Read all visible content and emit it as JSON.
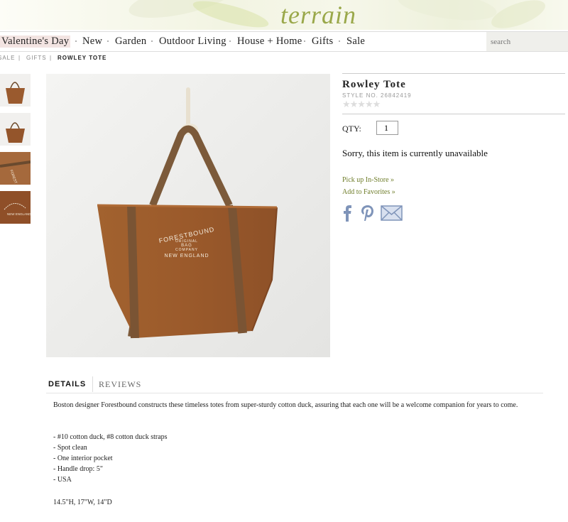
{
  "brand": {
    "logo_text": "terrain",
    "accent": "#9aa84a"
  },
  "nav": {
    "items": [
      "Valentine's Day",
      "New",
      "Garden",
      "Outdoor Living",
      "House + Home",
      "Gifts",
      "Sale"
    ],
    "search_placeholder": "search"
  },
  "breadcrumb": [
    "SALE",
    "GIFTS",
    "ROWLEY TOTE"
  ],
  "product": {
    "title": "Rowley Tote",
    "style_no": "STYLE NO. 26842419",
    "stars": "★★★★★",
    "qty_label": "QTY:",
    "qty_value": "1",
    "availability": "Sorry, this item is currently unavailable",
    "pickup_link": "Pick up In-Store »",
    "favorites_link": "Add to Favorites »",
    "bag_print": {
      "line1": "FORESTBOUND",
      "line2": "ORIGINAL",
      "line3": "BAG",
      "line4": "COMPANY",
      "line5": "NEW ENGLAND"
    },
    "bag_color": "#9a5a2e"
  },
  "tabs": {
    "details": "DETAILS",
    "reviews": "REVIEWS"
  },
  "details": {
    "intro": "Boston designer Forestbound constructs these timeless totes from super-sturdy cotton duck, assuring that each one will be a welcome companion for years to come.",
    "bullets": [
      "- #10 cotton duck, #8 cotton duck straps",
      "- Spot clean",
      "- One interior pocket",
      "- Handle drop: 5\"",
      "- USA"
    ],
    "dimensions": "14.5\"H, 17\"W, 14\"D"
  }
}
